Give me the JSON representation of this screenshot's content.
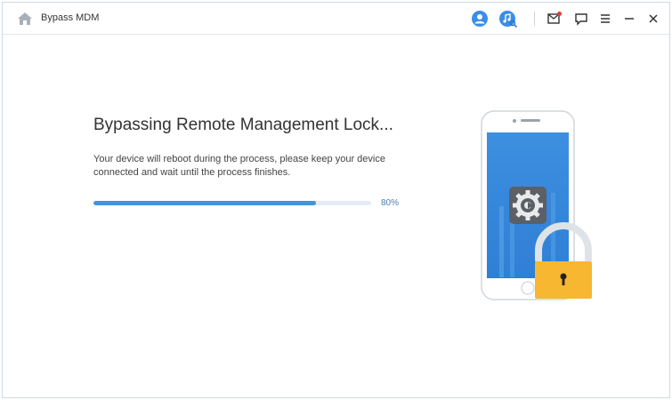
{
  "app": {
    "title": "Bypass MDM"
  },
  "toolbar": {
    "icons": [
      "home-icon",
      "account-icon",
      "music-search-icon",
      "mail-icon",
      "feedback-icon",
      "menu-icon",
      "minimize-icon",
      "close-icon"
    ]
  },
  "main": {
    "heading": "Bypassing Remote Management Lock...",
    "description_lines": [
      "Your device will reboot during the process, please keep your device",
      "connected and wait until the process finishes."
    ],
    "progress": {
      "value": 0.8,
      "label": "80%"
    }
  },
  "colors": {
    "accent": "#3f95dd",
    "lock": "#f7b731",
    "screen": "#3d8fe0"
  }
}
